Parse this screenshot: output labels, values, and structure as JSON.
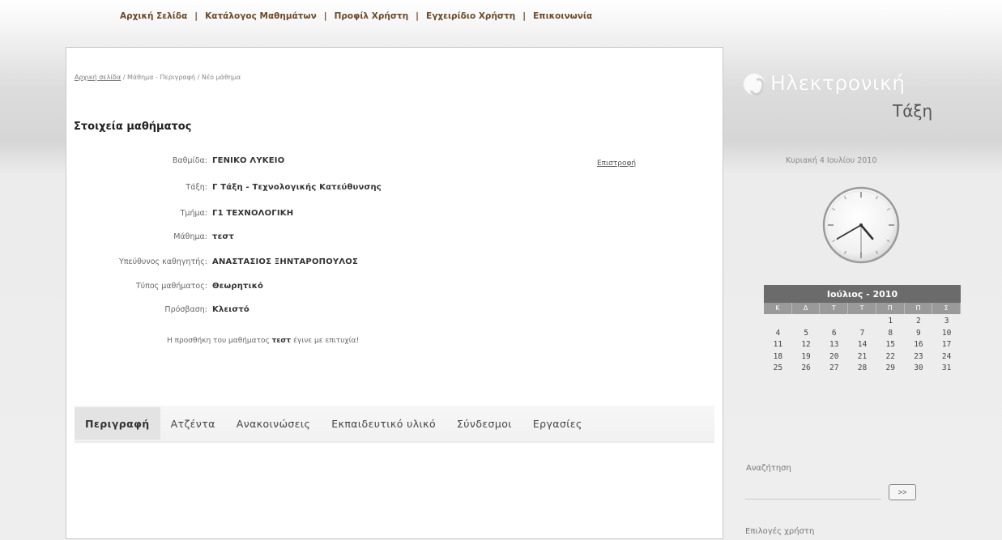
{
  "nav": {
    "items": [
      "Αρχική Σελίδα",
      "Κατάλογος Μαθημάτων",
      "Προφίλ Χρήστη",
      "Εγχειρίδιο Χρήστη",
      "Επικοινωνία"
    ],
    "separator": "|"
  },
  "breadcrumb": {
    "home": "Αρχική σελίδα",
    "sep1": " / ",
    "section": "Μάθημα - Περιγραφή",
    "sep2": " / ",
    "current": "Νέο μάθημα"
  },
  "course": {
    "section_title": "Στοιχεία μαθήματος",
    "back_label": "Επιστροφή",
    "fields": [
      {
        "label": "Βαθμίδα:",
        "value": "ΓΕΝΙΚΟ ΛΥΚΕΙΟ"
      },
      {
        "label": "Τάξη:",
        "value": "Γ Τάξη - Τεχνολογικής Κατεύθυνσης"
      },
      {
        "label": "Τμήμα:",
        "value": "Γ1 ΤΕΧΝΟΛΟΓΙΚΗ"
      },
      {
        "label": "Μάθημα:",
        "value": "τεστ"
      },
      {
        "label": "Υπεύθυνος καθηγητής:",
        "value": "ΑΝΑΣΤΑΣΙΟΣ ΞΗΝΤΑΡΟΠΟΥΛΟΣ"
      },
      {
        "label": "Τύπος μαθήματος:",
        "value": "Θεωρητικό"
      },
      {
        "label": "Πρόσβαση:",
        "value": "Κλειστό"
      }
    ],
    "success_prefix": "Η προσθήκη του μαθήματος ",
    "success_course": "τεστ",
    "success_suffix": " έγινε με επιτυχία!"
  },
  "tabs": [
    {
      "label": "Περιγραφή",
      "active": true
    },
    {
      "label": "Ατζέντα",
      "active": false
    },
    {
      "label": "Ανακοινώσεις",
      "active": false
    },
    {
      "label": "Εκπαιδευτικό υλικό",
      "active": false
    },
    {
      "label": "Σύνδεσμοι",
      "active": false
    },
    {
      "label": "Εργασίες",
      "active": false
    }
  ],
  "sidebar": {
    "logo_line1": "Ηλεκτρονική",
    "logo_line2": "Τάξη",
    "date_text": "Κυριακή 4 Ιουλίου 2010",
    "clock": {
      "hour": 4,
      "minute": 40,
      "second": 30
    },
    "calendar": {
      "title": "Ιούλιος - 2010",
      "day_headers": [
        "Κ",
        "Δ",
        "Τ",
        "Τ",
        "Π",
        "Π",
        "Σ"
      ],
      "first_weekday": 4,
      "days_in_month": 31
    },
    "search_label": "Αναζήτηση",
    "search_button": ">>",
    "user_options": "Επιλογές χρήστη"
  },
  "colors": {
    "nav_text": "#6b4a2a",
    "calendar_header": "#6b6b6b",
    "calendar_days": "#9a9a9a"
  }
}
